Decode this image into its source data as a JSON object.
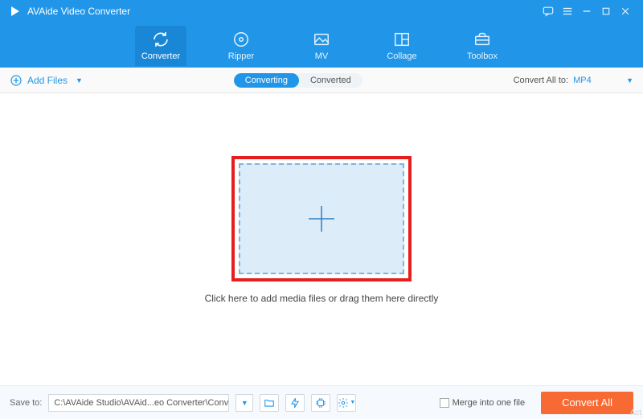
{
  "app": {
    "title": "AVAide Video Converter"
  },
  "nav": {
    "items": [
      {
        "label": "Converter",
        "icon": "refresh-icon",
        "active": true
      },
      {
        "label": "Ripper",
        "icon": "disc-icon",
        "active": false
      },
      {
        "label": "MV",
        "icon": "picture-icon",
        "active": false
      },
      {
        "label": "Collage",
        "icon": "collage-icon",
        "active": false
      },
      {
        "label": "Toolbox",
        "icon": "toolbox-icon",
        "active": false
      }
    ]
  },
  "subbar": {
    "add_files_label": "Add Files",
    "seg": {
      "converting": "Converting",
      "converted": "Converted",
      "active": "converting"
    },
    "convert_all_label": "Convert All to:",
    "convert_all_format": "MP4"
  },
  "drop": {
    "hint": "Click here to add media files or drag them here directly"
  },
  "bottom": {
    "save_to_label": "Save to:",
    "save_to_path": "C:\\AVAide Studio\\AVAid...eo Converter\\Converted",
    "merge_label": "Merge into one file",
    "convert_all_btn": "Convert All"
  },
  "watermark": "Act",
  "colors": {
    "brand_blue": "#2196e8",
    "accent_orange": "#f76a33",
    "highlight_red": "#e61e1e"
  }
}
